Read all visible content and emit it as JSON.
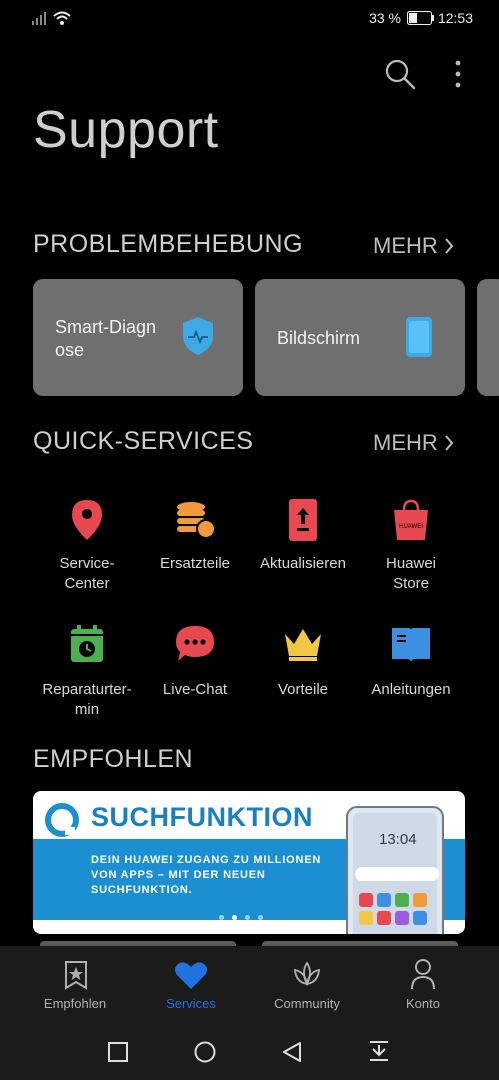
{
  "status_bar": {
    "battery": "33 %",
    "time": "12:53"
  },
  "header": {
    "title": "Support"
  },
  "troubleshooting": {
    "title": "PROBLEMBEHEBUNG",
    "more": "MEHR",
    "cards": [
      {
        "line1": "Smart-Diagn",
        "line2": "ose",
        "icon": "shield-icon"
      },
      {
        "line1": "Bildschirm",
        "line2": "",
        "icon": "phone-screen-icon"
      }
    ]
  },
  "quick_services": {
    "title": "QUICK-SERVICES",
    "more": "MEHR",
    "items": [
      {
        "l1": "Service-",
        "l2": "Center",
        "icon": "location-pin-icon",
        "color": "#e8484f"
      },
      {
        "l1": "Ersatzteile",
        "l2": "",
        "icon": "coins-icon",
        "color": "#f29a3b"
      },
      {
        "l1": "Aktualisieren",
        "l2": "",
        "icon": "update-phone-icon",
        "color": "#e8484f"
      },
      {
        "l1": "Huawei",
        "l2": "Store",
        "icon": "shopping-bag-icon",
        "color": "#e8484f"
      },
      {
        "l1": "Reparaturter-",
        "l2": "min",
        "icon": "calendar-clock-icon",
        "color": "#4caf50"
      },
      {
        "l1": "Live-Chat",
        "l2": "",
        "icon": "chat-bubble-icon",
        "color": "#e8484f"
      },
      {
        "l1": "Vorteile",
        "l2": "",
        "icon": "crown-icon",
        "color": "#f2c744"
      },
      {
        "l1": "Anleitungen",
        "l2": "",
        "icon": "book-icon",
        "color": "#3d8fe0"
      }
    ]
  },
  "recommended": {
    "title": "EMPFOHLEN",
    "banner": {
      "headline": "SUCHFUNKTION",
      "body": "DEIN HUAWEI ZUGANG ZU MILLIONEN VON APPS – MIT DER NEUEN SUCHFUNKTION.",
      "phone_time": "13:04",
      "store_logo_text": "HUAWEI"
    }
  },
  "bottom_nav": {
    "items": [
      {
        "label": "Empfohlen",
        "icon": "star-bookmark-icon"
      },
      {
        "label": "Services",
        "icon": "heart-icon",
        "active": true
      },
      {
        "label": "Community",
        "icon": "lotus-icon"
      },
      {
        "label": "Konto",
        "icon": "person-icon"
      }
    ]
  },
  "colors": {
    "accent": "#1f74e0",
    "background": "#000000",
    "card": "#6f6f6f"
  }
}
